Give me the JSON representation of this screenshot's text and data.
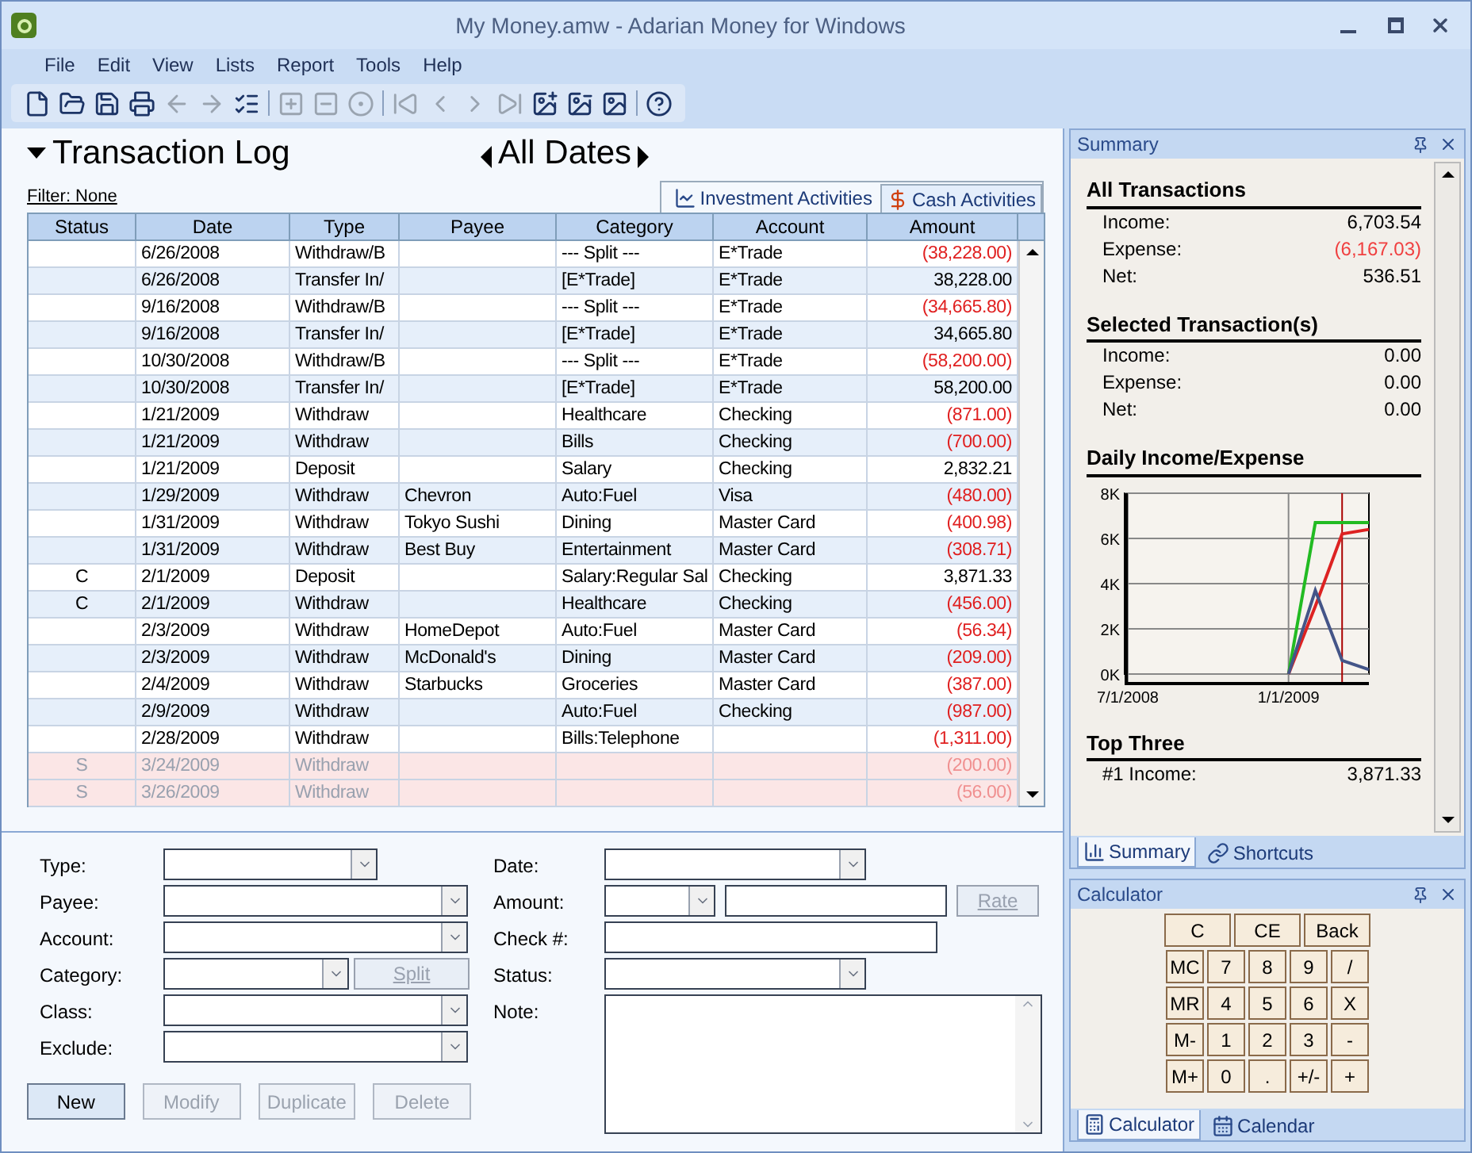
{
  "window": {
    "title": "My Money.amw - Adarian Money for Windows"
  },
  "menu": [
    "File",
    "Edit",
    "View",
    "Lists",
    "Report",
    "Tools",
    "Help"
  ],
  "log": {
    "title": "Transaction Log",
    "range": "All Dates",
    "filter": "Filter: None",
    "tabs": [
      {
        "label": "Investment Activities",
        "selected": false
      },
      {
        "label": "Cash Activities",
        "selected": true
      }
    ],
    "columns": [
      "Status",
      "Date",
      "Type",
      "Payee",
      "Category",
      "Account",
      "Amount"
    ],
    "rows": [
      {
        "cells": [
          "",
          "6/26/2008",
          "Withdraw/B",
          "",
          "--- Split ---",
          "E*Trade",
          "(38,228.00)"
        ],
        "negative": true,
        "pending": false
      },
      {
        "cells": [
          "",
          "6/26/2008",
          "Transfer In/",
          "",
          "[E*Trade]",
          "E*Trade",
          "38,228.00"
        ],
        "negative": false,
        "pending": false
      },
      {
        "cells": [
          "",
          "9/16/2008",
          "Withdraw/B",
          "",
          "--- Split ---",
          "E*Trade",
          "(34,665.80)"
        ],
        "negative": true,
        "pending": false
      },
      {
        "cells": [
          "",
          "9/16/2008",
          "Transfer In/",
          "",
          "[E*Trade]",
          "E*Trade",
          "34,665.80"
        ],
        "negative": false,
        "pending": false
      },
      {
        "cells": [
          "",
          "10/30/2008",
          "Withdraw/B",
          "",
          "--- Split ---",
          "E*Trade",
          "(58,200.00)"
        ],
        "negative": true,
        "pending": false
      },
      {
        "cells": [
          "",
          "10/30/2008",
          "Transfer In/",
          "",
          "[E*Trade]",
          "E*Trade",
          "58,200.00"
        ],
        "negative": false,
        "pending": false
      },
      {
        "cells": [
          "",
          "1/21/2009",
          "Withdraw",
          "",
          "Healthcare",
          "Checking",
          "(871.00)"
        ],
        "negative": true,
        "pending": false
      },
      {
        "cells": [
          "",
          "1/21/2009",
          "Withdraw",
          "",
          "Bills",
          "Checking",
          "(700.00)"
        ],
        "negative": true,
        "pending": false
      },
      {
        "cells": [
          "",
          "1/21/2009",
          "Deposit",
          "",
          "Salary",
          "Checking",
          "2,832.21"
        ],
        "negative": false,
        "pending": false
      },
      {
        "cells": [
          "",
          "1/29/2009",
          "Withdraw",
          "Chevron",
          "Auto:Fuel",
          "Visa",
          "(480.00)"
        ],
        "negative": true,
        "pending": false
      },
      {
        "cells": [
          "",
          "1/31/2009",
          "Withdraw",
          "Tokyo Sushi",
          "Dining",
          "Master Card",
          "(400.98)"
        ],
        "negative": true,
        "pending": false
      },
      {
        "cells": [
          "",
          "1/31/2009",
          "Withdraw",
          "Best Buy",
          "Entertainment",
          "Master Card",
          "(308.71)"
        ],
        "negative": true,
        "pending": false
      },
      {
        "cells": [
          "C",
          "2/1/2009",
          "Deposit",
          "",
          "Salary:Regular Sal",
          "Checking",
          "3,871.33"
        ],
        "negative": false,
        "pending": false
      },
      {
        "cells": [
          "C",
          "2/1/2009",
          "Withdraw",
          "",
          "Healthcare",
          "Checking",
          "(456.00)"
        ],
        "negative": true,
        "pending": false
      },
      {
        "cells": [
          "",
          "2/3/2009",
          "Withdraw",
          "HomeDepot",
          "Auto:Fuel",
          "Master Card",
          "(56.34)"
        ],
        "negative": true,
        "pending": false
      },
      {
        "cells": [
          "",
          "2/3/2009",
          "Withdraw",
          "McDonald's",
          "Dining",
          "Master Card",
          "(209.00)"
        ],
        "negative": true,
        "pending": false
      },
      {
        "cells": [
          "",
          "2/4/2009",
          "Withdraw",
          "Starbucks",
          "Groceries",
          "Master Card",
          "(387.00)"
        ],
        "negative": true,
        "pending": false
      },
      {
        "cells": [
          "",
          "2/9/2009",
          "Withdraw",
          "",
          "Auto:Fuel",
          "Checking",
          "(987.00)"
        ],
        "negative": true,
        "pending": false
      },
      {
        "cells": [
          "",
          "2/28/2009",
          "Withdraw",
          "",
          "Bills:Telephone",
          "",
          "(1,311.00)"
        ],
        "negative": true,
        "pending": false
      },
      {
        "cells": [
          "S",
          "3/24/2009",
          "Withdraw",
          "",
          "",
          "",
          "(200.00)"
        ],
        "negative": true,
        "pending": true
      },
      {
        "cells": [
          "S",
          "3/26/2009",
          "Withdraw",
          "",
          "",
          "",
          "(56.00)"
        ],
        "negative": true,
        "pending": true
      }
    ]
  },
  "form": {
    "left": [
      {
        "label": "Type:",
        "kind": "short_combo"
      },
      {
        "label": "Payee:",
        "kind": "combo"
      },
      {
        "label": "Account:",
        "kind": "combo"
      },
      {
        "label": "Category:",
        "kind": "combo_button",
        "button": "Split"
      },
      {
        "label": "Class:",
        "kind": "combo"
      },
      {
        "label": "Exclude:",
        "kind": "combo"
      }
    ],
    "right": [
      {
        "label": "Date:",
        "kind": "combo"
      },
      {
        "label": "Amount:",
        "kind": "amount",
        "button": "Rate"
      },
      {
        "label": "Check #:",
        "kind": "text"
      },
      {
        "label": "Status:",
        "kind": "combo"
      },
      {
        "label": "Note:",
        "kind": "note"
      }
    ],
    "buttons": [
      {
        "label": "New",
        "disabled": false
      },
      {
        "label": "Modify",
        "disabled": true
      },
      {
        "label": "Duplicate",
        "disabled": true
      },
      {
        "label": "Delete",
        "disabled": true
      }
    ]
  },
  "summary": {
    "title": "Summary",
    "sections": [
      {
        "title": "All Transactions",
        "rows": [
          {
            "label": "Income:",
            "value": "6,703.54",
            "negative": false
          },
          {
            "label": "Expense:",
            "value": "(6,167.03)",
            "negative": true
          },
          {
            "label": "Net:",
            "value": "536.51",
            "negative": false
          }
        ]
      },
      {
        "title": "Selected Transaction(s)",
        "rows": [
          {
            "label": "Income:",
            "value": "0.00",
            "negative": false
          },
          {
            "label": "Expense:",
            "value": "0.00",
            "negative": false
          },
          {
            "label": "Net:",
            "value": "0.00",
            "negative": false
          }
        ]
      }
    ],
    "chart_title": "Daily Income/Expense",
    "chart_data": {
      "type": "line",
      "grid": true,
      "categories": [
        "7/1/2008",
        null,
        null,
        null,
        null,
        null,
        "1/1/2009",
        null,
        null,
        null
      ],
      "ylim": [
        0,
        8000
      ],
      "yticks": [
        {
          "value": 0,
          "label": "0K"
        },
        {
          "value": 2000,
          "label": "2K"
        },
        {
          "value": 4000,
          "label": "4K"
        },
        {
          "value": 6000,
          "label": "6K"
        },
        {
          "value": 8000,
          "label": "8K"
        }
      ],
      "series": [
        {
          "color": "#22bb22",
          "values": [
            null,
            null,
            null,
            null,
            null,
            null,
            0,
            6700,
            6700,
            6700
          ]
        },
        {
          "color": "#dd2222",
          "values": [
            null,
            null,
            null,
            null,
            null,
            null,
            0,
            3000,
            6200,
            6400
          ]
        },
        {
          "color": "#445588",
          "values": [
            null,
            null,
            null,
            null,
            null,
            null,
            0,
            3700,
            600,
            200
          ]
        }
      ]
    },
    "top_title": "Top Three",
    "top_rows": [
      {
        "label": "#1 Income:",
        "value": "3,871.33"
      }
    ],
    "tabs": [
      {
        "label": "Summary",
        "selected": true
      },
      {
        "label": "Shortcuts",
        "selected": false
      }
    ]
  },
  "calculator": {
    "title": "Calculator",
    "keys": [
      [
        "C",
        "CE",
        "Back"
      ],
      [
        "MC",
        "7",
        "8",
        "9",
        "/"
      ],
      [
        "MR",
        "4",
        "5",
        "6",
        "X"
      ],
      [
        "M-",
        "1",
        "2",
        "3",
        "-"
      ],
      [
        "M+",
        "0",
        ".",
        "+/-",
        "+"
      ]
    ],
    "tabs": [
      {
        "label": "Calculator",
        "selected": true
      },
      {
        "label": "Calendar",
        "selected": false
      }
    ]
  }
}
